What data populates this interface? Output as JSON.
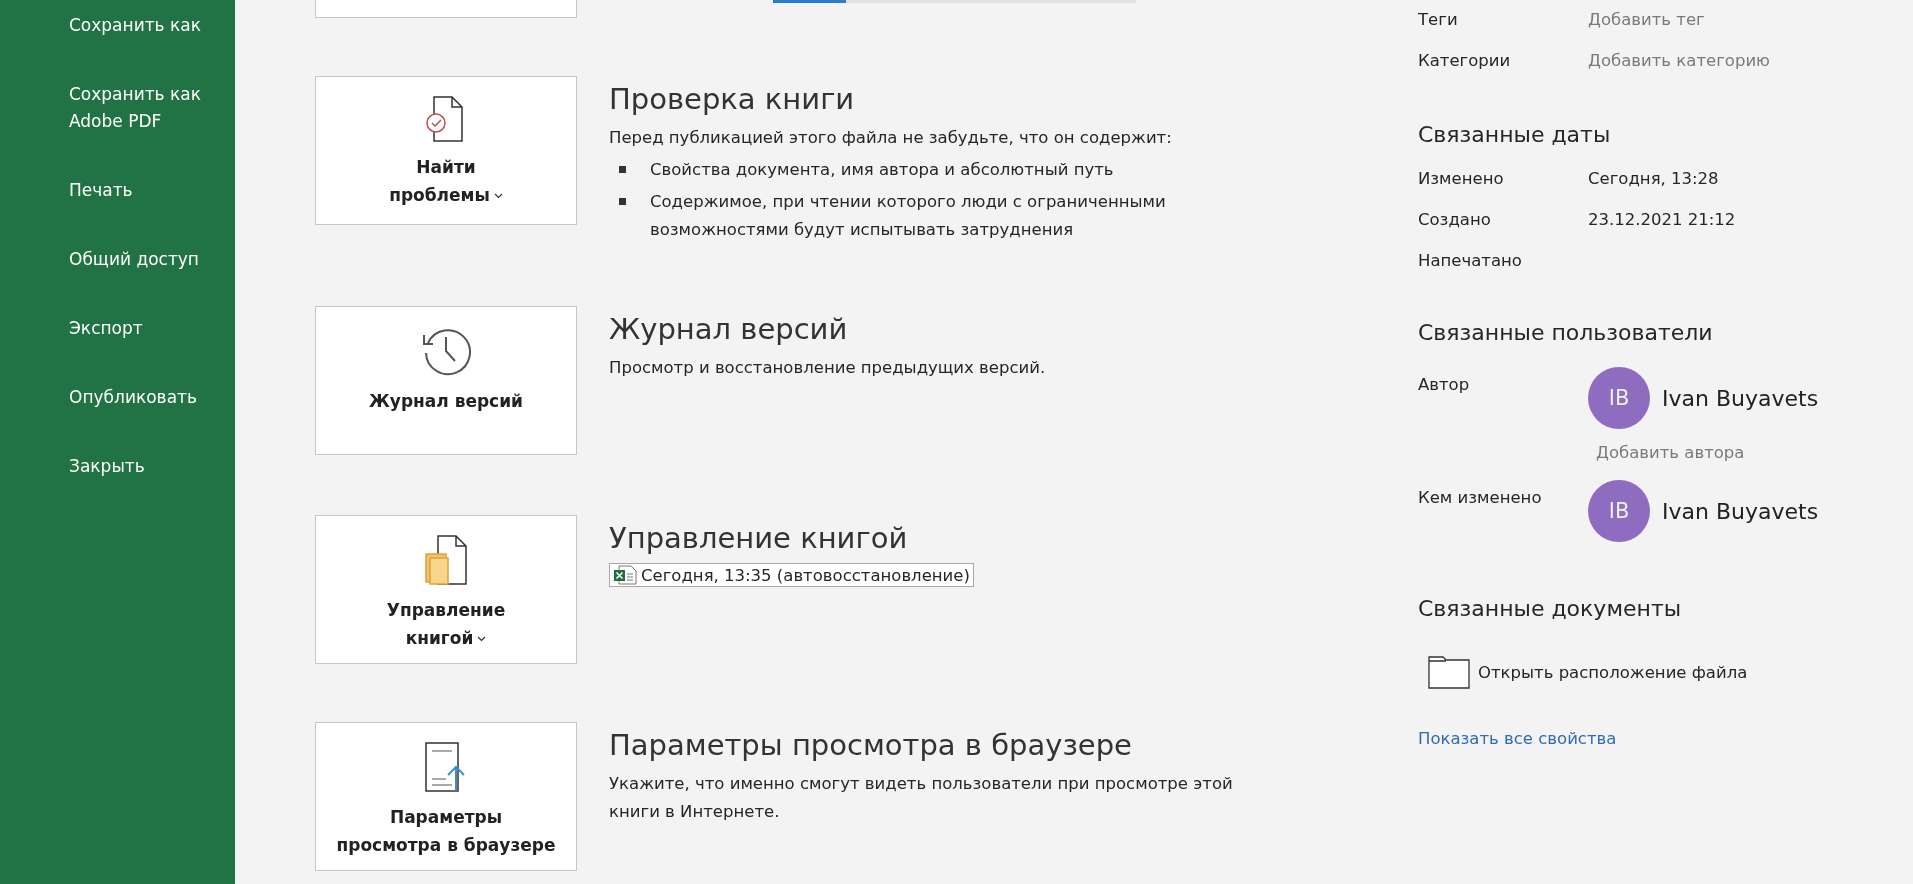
{
  "sidebar": {
    "items": [
      {
        "label": "Сохранить как"
      },
      {
        "label": "Сохранить как Adobe PDF"
      },
      {
        "label": "Печать"
      },
      {
        "label": "Общий доступ"
      },
      {
        "label": "Экспорт"
      },
      {
        "label": "Опубликовать"
      },
      {
        "label": "Закрыть"
      }
    ]
  },
  "top_bar": {
    "level": 0.2
  },
  "sections": [
    {
      "kind": "inspect",
      "button": {
        "lines": [
          "Найти",
          "проблемы"
        ],
        "dropdown": true
      },
      "title": "Проверка книги",
      "description": "Перед публикацией этого файла не забудьте, что он содержит:",
      "bullets": [
        "Свойства документа, имя автора и абсолютный путь",
        "Содержимое, при чтении которого люди с ограниченными возможностями будут испытывать затруднения"
      ]
    },
    {
      "kind": "history",
      "button": {
        "lines": [
          "Журнал версий"
        ],
        "dropdown": false
      },
      "title": "Журнал версий",
      "description": "Просмотр и восстановление предыдущих версий."
    },
    {
      "kind": "manage",
      "button": {
        "lines": [
          "Управление",
          "книгой"
        ],
        "dropdown": true
      },
      "title": "Управление книгой",
      "file_entry": "Сегодня, 13:35 (автовосстановление)"
    },
    {
      "kind": "browser",
      "button": {
        "lines": [
          "Параметры",
          "просмотра в браузере"
        ],
        "dropdown": false
      },
      "title": "Параметры просмотра в браузере",
      "description": "Укажите, что именно смогут видеть пользователи при просмотре этой книги в Интернете."
    }
  ],
  "properties": {
    "rows": [
      {
        "label": "Теги",
        "placeholder": "Добавить тег"
      },
      {
        "label": "Категории",
        "placeholder": "Добавить категорию"
      }
    ]
  },
  "related_dates": {
    "heading": "Связанные даты",
    "rows": [
      {
        "label": "Изменено",
        "value": "Сегодня, 13:28"
      },
      {
        "label": "Создано",
        "value": "23.12.2021 21:12"
      },
      {
        "label": "Напечатано"
      }
    ]
  },
  "related_people": {
    "heading": "Связанные пользователи",
    "people": [
      {
        "role": "Автор",
        "initials": "IB",
        "name": "Ivan Buyavets",
        "color": "#8e6cc0",
        "add_link": "Добавить автора"
      },
      {
        "role": "Кем изменено",
        "initials": "IB",
        "name": "Ivan Buyavets",
        "color": "#8e6cc0"
      }
    ]
  },
  "related_documents": {
    "heading": "Связанные документы",
    "open_location": "Открыть расположение файла"
  },
  "show_all_link": "Показать все свойства"
}
